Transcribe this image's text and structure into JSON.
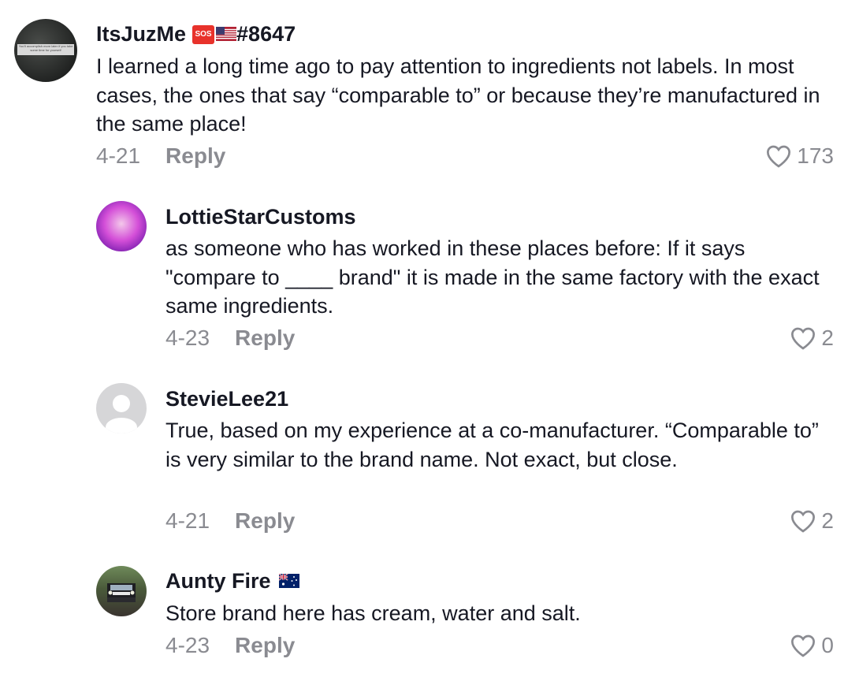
{
  "comments": [
    {
      "username": "ItsJuzMe",
      "badge_text": "SOS",
      "handle_suffix": "#8647",
      "avatar_text": "You'll accomplish more later if you take some time for yourself",
      "text": "I learned a long time ago to pay attention to ingredients not labels. In most cases, the ones that say “comparable to” or because they’re manufactured in the same place!",
      "date": "4-21",
      "reply_label": "Reply",
      "likes": "173"
    },
    {
      "username": "LottieStarCustoms",
      "text": "as someone who has worked in these places before: If it says \"compare to ____ brand\" it is made in the same factory with the exact same ingredients.",
      "date": "4-23",
      "reply_label": "Reply",
      "likes": "2"
    },
    {
      "username": "StevieLee21",
      "text": "True, based on my experience at a co-manufacturer. “Comparable to” is very similar to the brand name. Not exact, but close.",
      "date": "4-21",
      "reply_label": "Reply",
      "likes": "2"
    },
    {
      "username": "Aunty Fire",
      "text": "Store brand here has cream, water and salt.",
      "date": "4-23",
      "reply_label": "Reply",
      "likes": "0"
    }
  ],
  "icons": {
    "like": "heart-outline-icon",
    "flag_us": "us-flag-icon",
    "flag_au": "australia-flag-icon",
    "sos": "sos-badge-icon"
  },
  "colors": {
    "text": "#161823",
    "muted": "#8a8b91",
    "sos": "#e8322b"
  }
}
